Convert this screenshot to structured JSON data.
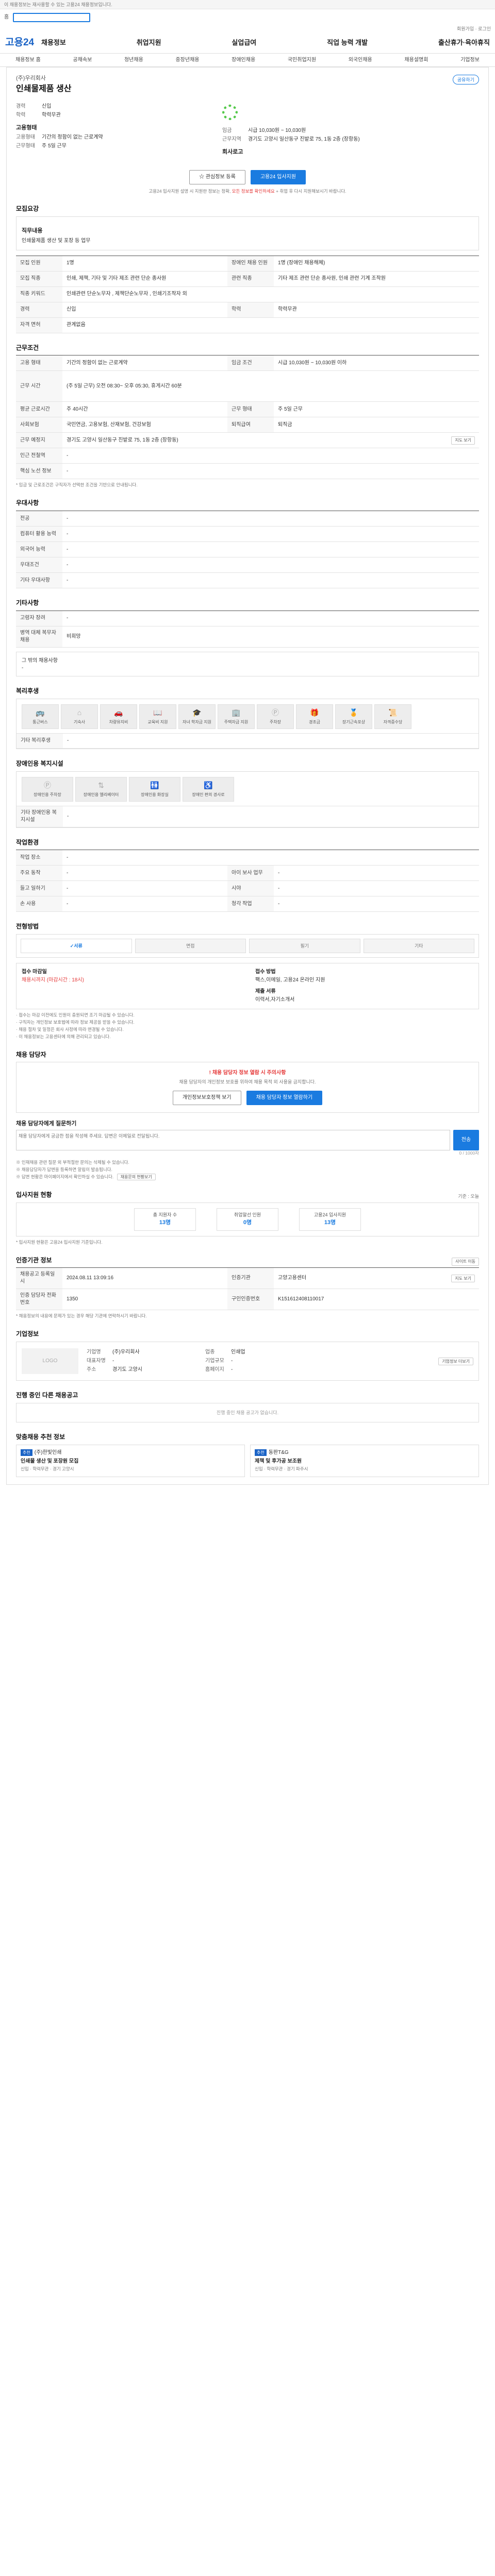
{
  "topbar": {
    "notice": "이 채용정보는 재사용할 수 있는 고용24 채용정보입니다.",
    "mini_left": "홈",
    "mini_right": "회원가입 · 로그인"
  },
  "header": {
    "logo": "고용24",
    "nav": [
      "채용정보",
      "취업지원",
      "실업급여",
      "직업 능력 개발",
      "출산휴가·육아휴직"
    ]
  },
  "subnav": [
    "채용정보 홈",
    "공채속보",
    "청년채용",
    "중장년채용",
    "장애인채용",
    "국민취업지원",
    "외국인채용",
    "채용설명회",
    "기업정보"
  ],
  "job": {
    "company": "(주)우리회사",
    "title": "인쇄물제품 생산",
    "share": "공유하기",
    "sum": [
      {
        "k": "경력",
        "v": "신입"
      },
      {
        "k": "학력",
        "v": "학력무관"
      }
    ],
    "cond_title": "고용형태",
    "cond": [
      {
        "k": "고용형태",
        "v": "기간의 정함이 없는 근로계약"
      },
      {
        "k": "근무형태",
        "v": "주 5일 근무"
      }
    ],
    "right_title": "임금",
    "right": [
      {
        "k": "임금",
        "v": "시급 10,030원 ~ 10,030원"
      },
      {
        "k": "근무지역",
        "v": "경기도 고양시 일산동구 진밭로 75, 1동 2층 (장항동)"
      }
    ],
    "logo_label": "회사로고",
    "btn_scrap": "관심정보 등록",
    "btn_apply": "고용24 입사지원",
    "notice_a": "고용24 입사지원 설명 시 지원한 정보는 정확,",
    "notice_b": "모든 정보를 확인하세요",
    "notice_c": "+ 취업 후 다시 지원해보시기 바랍니다."
  },
  "recruit": {
    "title": "모집요강",
    "desc_label": "직무내용",
    "desc": "인쇄물제품 생산 및 포장 등 업무",
    "rows": [
      [
        {
          "k": "모집 인원",
          "v": "1명"
        },
        {
          "k": "장애인 채용 인원",
          "v": "1명 (장애인 채용해체)"
        }
      ],
      [
        {
          "k": "모집 직종",
          "v": "인쇄, 제책, 기타 및 기타 제조 관련 단순 종사원"
        },
        {
          "k": "관련 직종",
          "v": "기타 제조 관련 단순 종사원, 인쇄 관련 기계 조작원"
        }
      ],
      [
        {
          "k": "직종 키워드",
          "v": "인쇄관련 단순노무자 , 제책단순노무자 , 인쇄기조작자 외"
        }
      ],
      [
        {
          "k": "경력",
          "v": "신입"
        },
        {
          "k": "학력",
          "v": "학력무관"
        }
      ],
      [
        {
          "k": "자격 면허",
          "v": "관계없음"
        }
      ]
    ]
  },
  "work": {
    "title": "근무조건",
    "rows": [
      [
        {
          "k": "고용 형태",
          "v": "기간의 정함이 없는 근로계약"
        },
        {
          "k": "임금 조건",
          "v": "시급 10,030원 ~ 10,030원 이하"
        }
      ],
      [
        {
          "k": "근무 시간",
          "v": "(주 5일 근무) 오전 08:30~ 오후 05:30, 휴게시간 60분"
        }
      ],
      [
        {
          "k": "평균 근로시간",
          "v": "주 40시간"
        },
        {
          "k": "근무 형태",
          "v": "주 5일 근무"
        }
      ],
      [
        {
          "k": "사회보험",
          "v": "국민연금, 고용보험, 산재보험, 건강보험"
        },
        {
          "k": "퇴직급여",
          "v": "퇴직금"
        }
      ],
      [
        {
          "k": "근무 예정지",
          "v": "경기도 고양시 일산동구 진밭로 75, 1동 2층 (장항동)"
        }
      ],
      [
        {
          "k": "인근 전철역",
          "v": "-"
        }
      ],
      [
        {
          "k": "핵심 노선 정보",
          "v": "-"
        }
      ]
    ],
    "map_btn": "지도 보기",
    "note": "* 임금 및 근로조건은 구직자가 선택한 조건을 기반으로 안내됩니다."
  },
  "pref": {
    "title": "우대사항",
    "rows": [
      [
        {
          "k": "전공",
          "v": "-"
        }
      ],
      [
        {
          "k": "컴퓨터 활용 능력",
          "v": "-"
        }
      ],
      [
        {
          "k": "외국어 능력",
          "v": "-"
        }
      ],
      [
        {
          "k": "우대조건",
          "v": "-"
        }
      ],
      [
        {
          "k": "기타 우대사항",
          "v": "-"
        }
      ]
    ]
  },
  "extra": {
    "title": "기타사항",
    "rows": [
      [
        {
          "k": "고령자 장려",
          "v": "-"
        }
      ],
      [
        {
          "k": "병역 대체 복무자 채용",
          "v": "비희망"
        }
      ]
    ],
    "box": "그 밖의 채용사항",
    "box_val": "-"
  },
  "welfare": {
    "title": "복리후생",
    "items": [
      "통근버스",
      "기숙사",
      "차량유지비",
      "교육비 지원",
      "자녀 학자금 지원",
      "주택자금 지원",
      "주차장",
      "경조금",
      "장기근속포상",
      "자격증수당"
    ],
    "other_label": "기타 복리후생",
    "other": "-"
  },
  "disab": {
    "title": "장애인용 복지시설",
    "items": [
      "장애인용 주차장",
      "장애인용 엘리베이터",
      "장애인용 화장실",
      "장애인 편의 경사로"
    ],
    "other_label": "기타 장애인용 복지시설",
    "other": "-"
  },
  "env": {
    "title": "작업환경",
    "rows": [
      [
        {
          "k": "작업 장소",
          "v": "-"
        }
      ],
      [
        {
          "k": "주요 동작",
          "v": "-"
        },
        {
          "k": "아이 보사 업무",
          "v": "-"
        }
      ],
      [
        {
          "k": "들고 일하기",
          "v": "-"
        },
        {
          "k": "시야",
          "v": "-"
        }
      ],
      [
        {
          "k": "손 사용",
          "v": "-"
        },
        {
          "k": "청각 작업",
          "v": "-"
        }
      ]
    ]
  },
  "process": {
    "title": "전형방법",
    "steps": [
      "서류",
      "면접",
      "필기",
      "기타"
    ],
    "deadline_label": "접수 마감일",
    "deadline": "채용시까지 (마감시간 : 18시)",
    "method_label": "접수 방법",
    "method": "팩스,이메일, 고용24 온라인 지원",
    "doc_label": "제출 서류",
    "doc": "이력서,자기소개서"
  },
  "bullets": [
    "· 접수는 마감 이전에도 인원이 충원되면 조기 마감될 수 있습니다.",
    "· 구직자는 개인정보 보호법에 따라 정보 제공을 받을 수 있습니다.",
    "· 채용 절차 및 일정은 회사 사정에 따라 변경될 수 있습니다.",
    "· 이 채용정보는 고용센터에 의해 관리되고 있습니다."
  ],
  "contact": {
    "title": "채용 담당자",
    "alert": "채용 담당자 정보 열람 시 주의사항",
    "text": "채용 담당자의 개인정보 보호를 위하여 채용 목적 외 사용을 금지합니다.",
    "btn_policy": "개인정보보호정책 보기",
    "btn_view": "채용 담당자 정보 열람하기",
    "qa_label": "채용 담당자에게 질문하기",
    "qa_placeholder": "채용 담당자에게 궁금한 점을 작성해 주세요. 답변은 이메일로 전달됩니다.",
    "send": "전송",
    "qa_count": "0 / 1000자",
    "qa_note1": "※ 인재채용 관련 질문 외 부적절한 문의는 삭제될 수 있습니다.",
    "qa_note2": "※ 채용담당자가 답변을 등록하면 알림이 발송됩니다.",
    "qa_note3": "※ 답변 현황은 마이페이지에서 확인하실 수 있습니다.",
    "qa_btn": "채용문의 현황보기"
  },
  "applystat": {
    "title": "입사지원 현황",
    "period": "기준 : 오늘",
    "stats": [
      {
        "l": "총 지원자 수",
        "n": "13명"
      },
      {
        "l": "취업알선 인원",
        "n": "0명"
      },
      {
        "l": "고용24 입사지원",
        "n": "13명"
      }
    ],
    "note": "* 입사지원 현황은 고용24 입사지원 기준입니다."
  },
  "orginfo": {
    "title": "인증기관 정보",
    "btn": "사이트 이동",
    "rows": [
      [
        {
          "k": "채용공고 등록일시",
          "v": "2024.08.11 13:09:16"
        },
        {
          "k": "인증기관",
          "v": "고양고용센터"
        }
      ],
      [
        {
          "k": "인증 담당자 전화번호",
          "v": "1350"
        },
        {
          "k": "구인인증번호",
          "v": "K151612408110017"
        }
      ]
    ],
    "map": "지도 보기",
    "note": "* 채용정보의 내용에 문제가 있는 경우 해당 기관에 연락하시기 바랍니다."
  },
  "company": {
    "title": "기업정보",
    "logo": "LOGO",
    "rows": [
      [
        {
          "k": "기업명",
          "v": "(주)우리회사"
        },
        {
          "k": "업종",
          "v": "인쇄업"
        }
      ],
      [
        {
          "k": "대표자명",
          "v": "-"
        },
        {
          "k": "기업규모",
          "v": "-"
        }
      ],
      [
        {
          "k": "주소",
          "v": "경기도 고양시"
        },
        {
          "k": "홈페이지",
          "v": "-"
        }
      ]
    ],
    "btn": "기업정보 더보기"
  },
  "others": {
    "title": "진행 중인 다른 채용공고",
    "empty": "진행 중인 채용 공고가 없습니다."
  },
  "similar": {
    "title": "맞춤채용 추천 정보",
    "cards": [
      {
        "tag": "추천",
        "company": "(주)한빛인쇄",
        "title": "인쇄물 생산 및 포장원 모집",
        "meta": "신입 · 학력무관 · 경기 고양시"
      },
      {
        "tag": "추천",
        "company": "동판T&G",
        "title": "제책 및 후가공 보조원",
        "meta": "신입 · 학력무관 · 경기 파주시"
      }
    ]
  }
}
